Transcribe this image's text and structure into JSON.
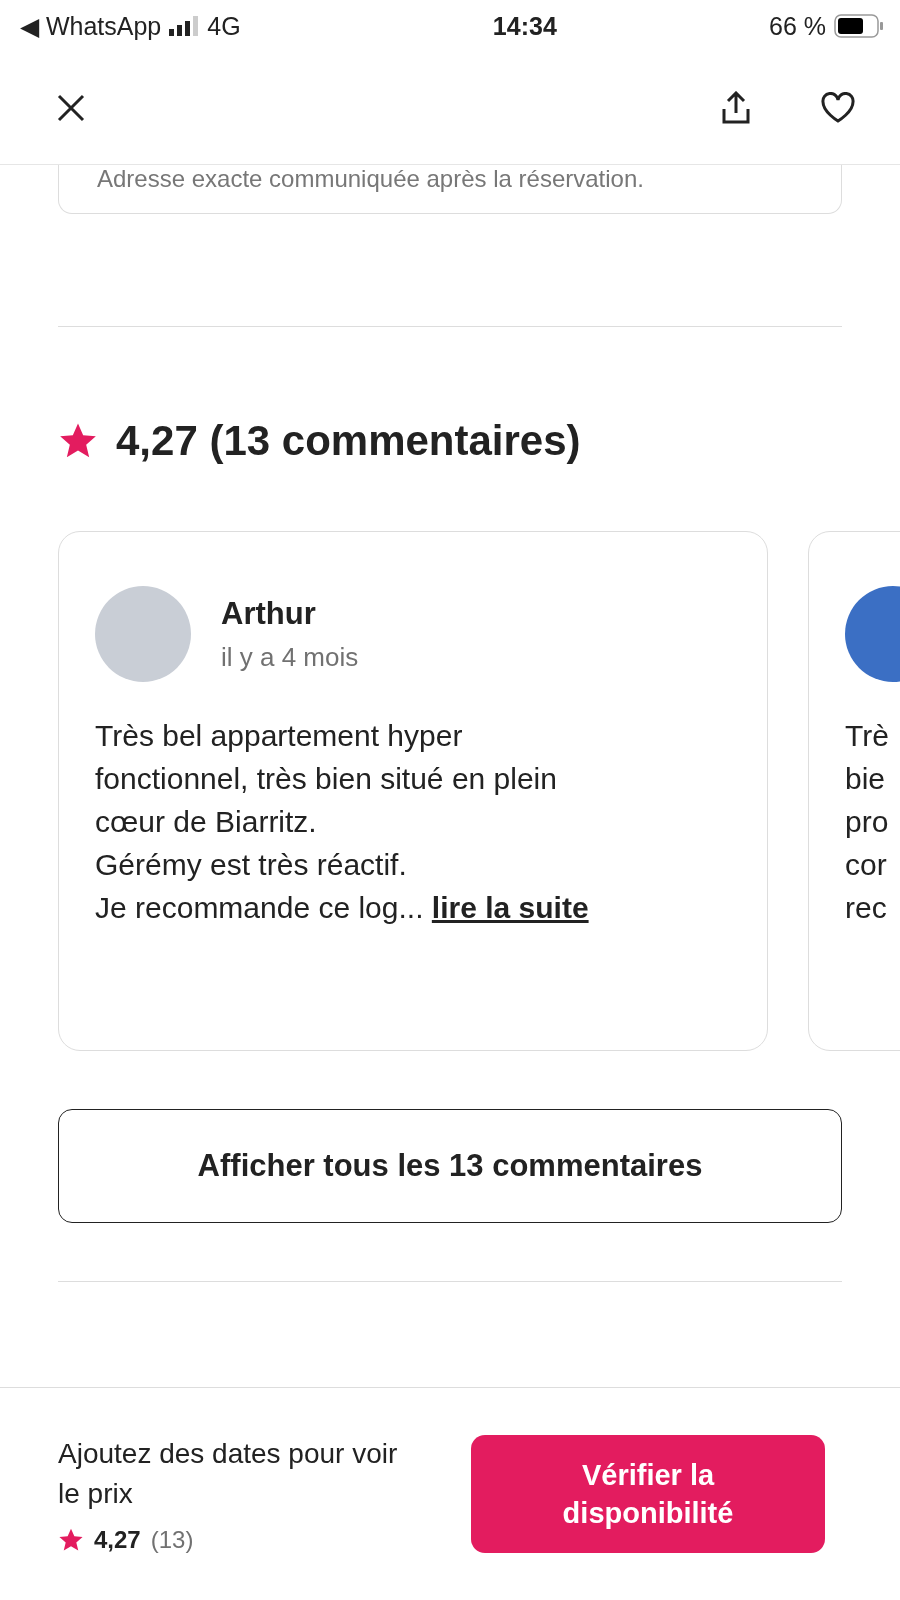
{
  "status_bar": {
    "back_app": "◀ WhatsApp",
    "network": "4G",
    "time": "14:34",
    "battery": "66 %"
  },
  "nav": {
    "favorite": false
  },
  "location_card": {
    "note": "Adresse exacte communiquée après la réservation."
  },
  "reviews": {
    "rating": "4,27",
    "count": "(13 commentaires)",
    "items": [
      {
        "name": "Arthur",
        "date": "il y a 4 mois",
        "body": "Très bel appartement hyper\nfonctionnel, très bien situé en plein\ncœur de Biarritz.\nGérémy est très réactif.\nJe recommande ce log...",
        "more": "lire la suite"
      },
      {
        "body": "Trè\nbie\npro\ncor\nrec"
      }
    ],
    "show_all": "Afficher tous les 13 commentaires"
  },
  "footer": {
    "prompt": "Ajoutez des dates pour voir le prix",
    "rating": "4,27",
    "count": "(13)",
    "cta": "Vérifier la disponibilité"
  }
}
